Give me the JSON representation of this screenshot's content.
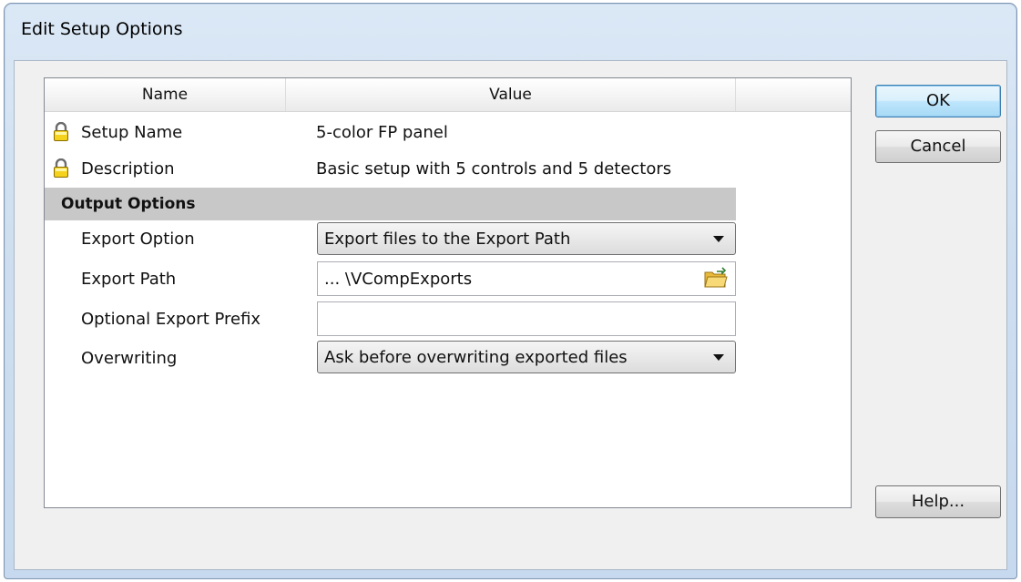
{
  "window": {
    "title": "Edit Setup Options"
  },
  "grid": {
    "columns": {
      "name": "Name",
      "value": "Value"
    },
    "rows": [
      {
        "name": "Setup Name",
        "value": "5-color FP panel",
        "locked": true
      },
      {
        "name": "Description",
        "value": "Basic setup with 5 controls and 5 detectors",
        "locked": true
      }
    ],
    "section": "Output Options",
    "options": {
      "export_option": {
        "label": "Export Option",
        "value": "Export files to the Export Path"
      },
      "export_path": {
        "label": "Export Path",
        "value": "... \\VCompExports"
      },
      "export_prefix": {
        "label": "Optional Export Prefix",
        "value": ""
      },
      "overwriting": {
        "label": "Overwriting",
        "value": "Ask before overwriting exported files"
      }
    }
  },
  "buttons": {
    "ok": "OK",
    "cancel": "Cancel",
    "help": "Help..."
  },
  "icons": {
    "lock": "lock-icon",
    "folder": "folder-open-icon",
    "dropdown": "chevron-down-icon"
  }
}
